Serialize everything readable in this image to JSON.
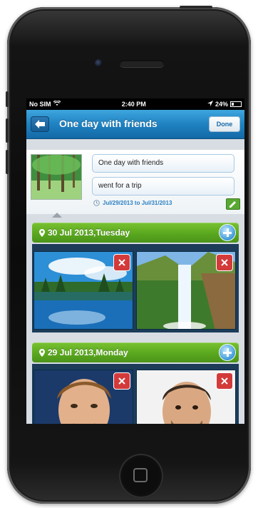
{
  "statusbar": {
    "carrier": "No SIM",
    "wifi_icon": "wifi-icon",
    "time": "2:40 PM",
    "battery": "24%"
  },
  "navbar": {
    "back_icon": "back-arrow-icon",
    "title": "One day with friends",
    "done_label": "Done"
  },
  "trip": {
    "title_value": "One day with friends",
    "description_value": "went for a trip",
    "date_range": "Jul/29/2013 to Jul/31/2013"
  },
  "days": [
    {
      "label": "30 Jul 2013,Tuesday",
      "photos": [
        "lake-reflection-photo",
        "waterfall-photo"
      ]
    },
    {
      "label": "29 Jul 2013,Monday",
      "photos": [
        "person-portrait-photo",
        "person-portrait-photo"
      ]
    }
  ],
  "colors": {
    "navbar": "#1f82c2",
    "day_header": "#5aa81f",
    "remove": "#d33a3a",
    "add": "#3e9bd9"
  }
}
